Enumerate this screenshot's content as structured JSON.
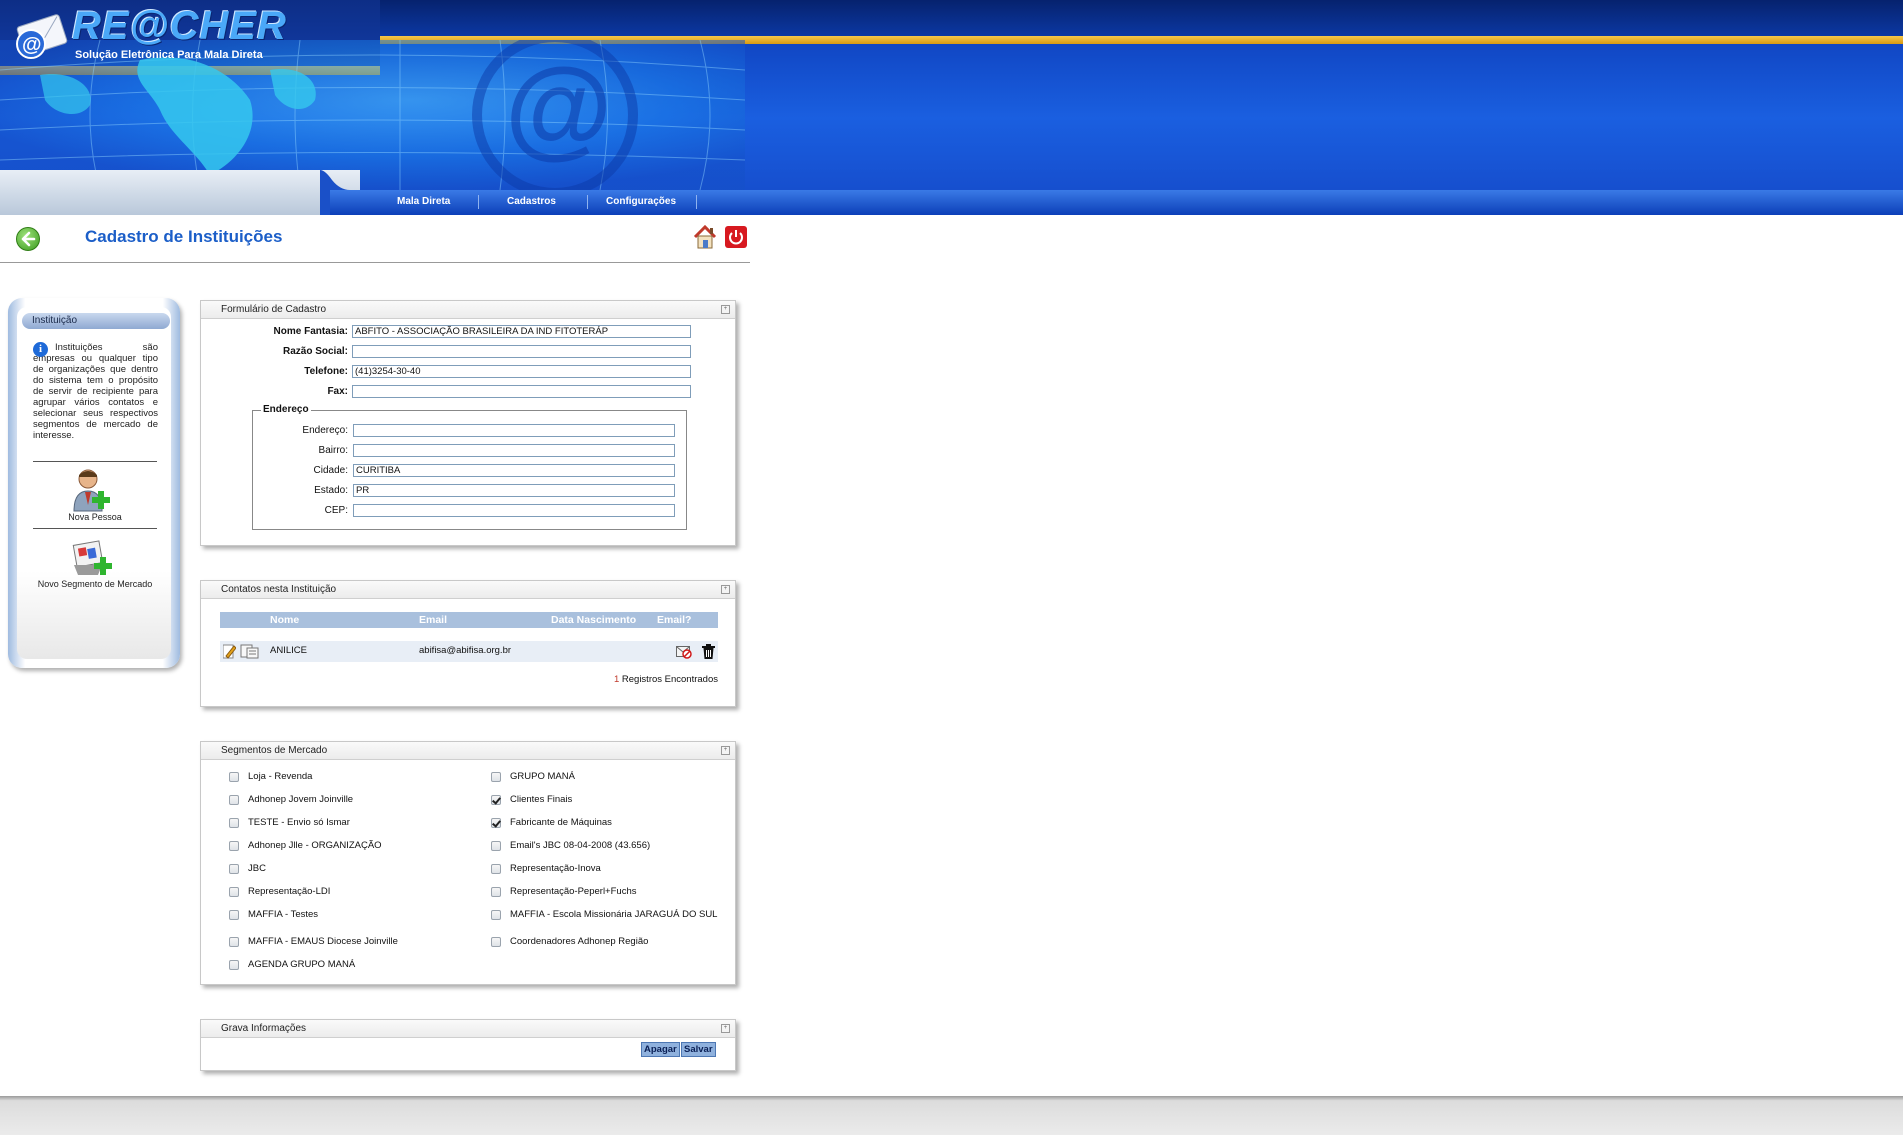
{
  "header": {
    "logo_text": "RE@CHER",
    "logo_subtitle": "Solução Eletrônica Para Mala Direta",
    "nav": [
      "Mala Direta",
      "Cadastros",
      "Configurações"
    ]
  },
  "page": {
    "title": "Cadastro de Instituições"
  },
  "sidebar": {
    "heading": "Instituição",
    "description": "Instituições são empresas ou qualquer tipo de organizações que dentro do sistema tem o propósito de servir de recipiente para agrupar vários contatos e selecionar seus respectivos segmentos de mercado de interesse.",
    "links": [
      "Nova Pessoa",
      "Novo Segmento de Mercado"
    ]
  },
  "form": {
    "panel_title": "Formulário de Cadastro",
    "labels": {
      "nome_fantasia": "Nome Fantasia:",
      "razao_social": "Razão Social:",
      "telefone": "Telefone:",
      "fax": "Fax:"
    },
    "values": {
      "nome_fantasia": "ABFITO - ASSOCIAÇÃO BRASILEIRA DA IND FITOTERÁP",
      "razao_social": "",
      "telefone": "(41)3254-30-40",
      "fax": ""
    },
    "endereco_legend": "Endereço",
    "endereco_labels": [
      "Endereço:",
      "Bairro:",
      "Cidade:",
      "Estado:",
      "CEP:"
    ],
    "endereco_values": [
      "",
      "",
      "CURITIBA",
      "PR",
      ""
    ]
  },
  "contacts": {
    "panel_title": "Contatos nesta Instituição",
    "columns": [
      "Nome",
      "Email",
      "Data Nascimento",
      "Email?"
    ],
    "rows": [
      {
        "nome": "ANILICE",
        "email": "abifisa@abifisa.org.br",
        "data_nascimento": ""
      }
    ],
    "count": "1",
    "count_label": "Registros Encontrados"
  },
  "segments": {
    "panel_title": "Segmentos de Mercado",
    "left": [
      {
        "label": "Loja - Revenda",
        "checked": false
      },
      {
        "label": "Adhonep Jovem Joinville",
        "checked": false
      },
      {
        "label": "TESTE - Envio só Ismar",
        "checked": false
      },
      {
        "label": "Adhonep Jlle - ORGANIZAÇÃO",
        "checked": false
      },
      {
        "label": "JBC",
        "checked": false
      },
      {
        "label": "Representação-LDI",
        "checked": false
      },
      {
        "label": "MAFFIA - Testes",
        "checked": false
      },
      {
        "label": "MAFFIA - EMAUS Diocese Joinville",
        "checked": false
      },
      {
        "label": "AGENDA GRUPO MANÁ",
        "checked": false
      }
    ],
    "right": [
      {
        "label": "GRUPO MANÁ",
        "checked": false
      },
      {
        "label": "Clientes Finais",
        "checked": true
      },
      {
        "label": "Fabricante de Máquinas",
        "checked": true
      },
      {
        "label": "Email's JBC 08-04-2008 (43.656)",
        "checked": false
      },
      {
        "label": "Representação-Inova",
        "checked": false
      },
      {
        "label": "Representação-Peperl+Fuchs",
        "checked": false
      },
      {
        "label": "MAFFIA - Escola Missionária JARAGUÁ DO SUL",
        "checked": false
      },
      {
        "label": "Coordenadores Adhonep Região",
        "checked": false
      }
    ]
  },
  "save": {
    "panel_title": "Grava Informações",
    "delete_label": "Apagar",
    "save_label": "Salvar"
  }
}
